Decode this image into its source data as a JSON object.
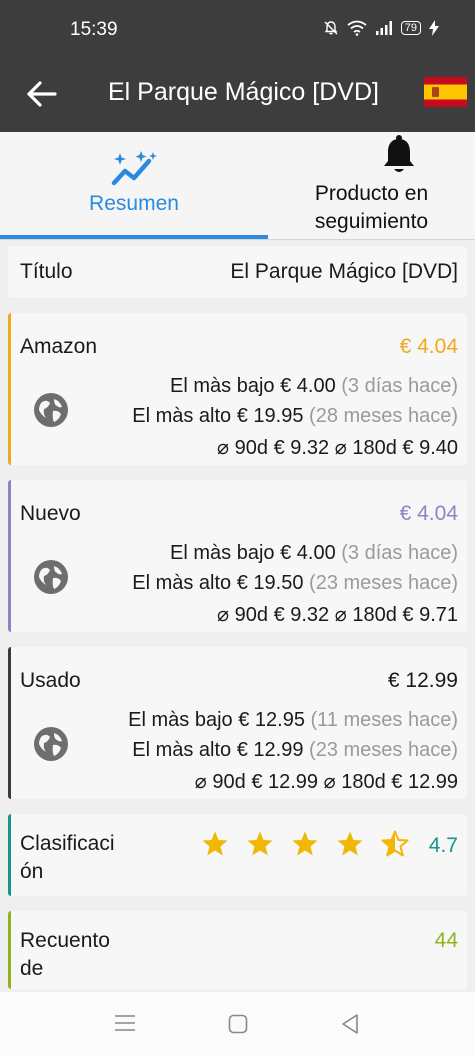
{
  "status_bar": {
    "time": "15:39",
    "battery": "79"
  },
  "app_bar": {
    "title": "El Parque Mágico [DVD]"
  },
  "tabs": [
    {
      "label": "Resumen"
    },
    {
      "label_line1": "Producto en",
      "label_line2": "seguimiento"
    }
  ],
  "title_row": {
    "label": "Título",
    "value": "El Parque Mágico [DVD]"
  },
  "price_cards": [
    {
      "name": "Amazon",
      "current": "€ 4.04",
      "accent": "#f0a81e",
      "low_label": "El màs bajo",
      "low_price": "€ 4.00",
      "low_when": "(3 días hace)",
      "high_label": "El màs alto",
      "high_price": "€ 19.95",
      "high_when": "(28 meses hace)",
      "avg90_label": "⌀ 90d",
      "avg90": "€ 9.32",
      "avg180_label": "⌀ 180d",
      "avg180": "€ 9.40"
    },
    {
      "name": "Nuevo",
      "current": "€ 4.04",
      "accent": "#8c84c9",
      "low_label": "El màs bajo",
      "low_price": "€ 4.00",
      "low_when": "(3 días hace)",
      "high_label": "El màs alto",
      "high_price": "€ 19.50",
      "high_when": "(23 meses hace)",
      "avg90_label": "⌀ 90d",
      "avg90": "€ 9.32",
      "avg180_label": "⌀ 180d",
      "avg180": "€ 9.71"
    },
    {
      "name": "Usado",
      "current": "€ 12.99",
      "accent": "#3a3a3a",
      "low_label": "El màs bajo",
      "low_price": "€ 12.95",
      "low_when": "(11 meses hace)",
      "high_label": "El màs alto",
      "high_price": "€ 12.99",
      "high_when": "(23 meses hace)",
      "avg90_label": "⌀ 90d",
      "avg90": "€ 12.99",
      "avg180_label": "⌀ 180d",
      "avg180": "€ 12.99"
    }
  ],
  "rating": {
    "label_line1": "Clasificaci",
    "label_line2": "ón",
    "value": "4.7",
    "stars": 4.5,
    "max_stars": 5,
    "accent": "#17968a",
    "star_color": "#f2b705"
  },
  "review_count": {
    "label_line1": "Recuento",
    "label_line2": "de",
    "value": "44",
    "accent": "#8fb21f"
  },
  "colors": {
    "app_bar": "#3d3d3d",
    "tab_active": "#2a8adf"
  }
}
